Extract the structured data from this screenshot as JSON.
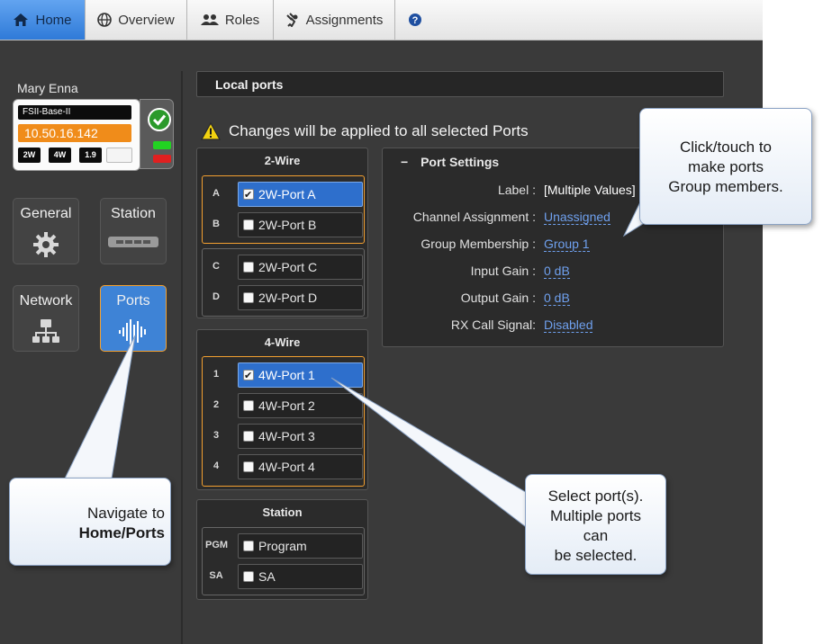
{
  "nav": {
    "tabs": [
      {
        "label": "Home",
        "icon": "home-icon"
      },
      {
        "label": "Overview",
        "icon": "globe-icon"
      },
      {
        "label": "Roles",
        "icon": "users-icon"
      },
      {
        "label": "Assignments",
        "icon": "plug-icon"
      },
      {
        "label": "",
        "icon": "help-icon"
      }
    ]
  },
  "user": {
    "name": "Mary Enna"
  },
  "device": {
    "name": "FSII-Base-II",
    "ip": "10.50.16.142",
    "badges": [
      "2W",
      "4W",
      "1.9"
    ]
  },
  "tiles": [
    {
      "label": "General",
      "icon": "gear-icon"
    },
    {
      "label": "Station",
      "icon": "station-icon"
    },
    {
      "label": "Network",
      "icon": "network-icon"
    },
    {
      "label": "Ports",
      "icon": "audio-wave-icon"
    }
  ],
  "main": {
    "section_title": "Local ports",
    "warning": "Changes will be applied to all selected Ports",
    "two_wire": {
      "title": "2-Wire",
      "ports": [
        {
          "letter": "A",
          "label": "2W-Port A",
          "checked": true
        },
        {
          "letter": "B",
          "label": "2W-Port B",
          "checked": false
        },
        {
          "letter": "C",
          "label": "2W-Port C",
          "checked": false
        },
        {
          "letter": "D",
          "label": "2W-Port D",
          "checked": false
        }
      ]
    },
    "four_wire": {
      "title": "4-Wire",
      "ports": [
        {
          "letter": "1",
          "label": "4W-Port 1",
          "checked": true
        },
        {
          "letter": "2",
          "label": "4W-Port 2",
          "checked": false
        },
        {
          "letter": "3",
          "label": "4W-Port 3",
          "checked": false
        },
        {
          "letter": "4",
          "label": "4W-Port 4",
          "checked": false
        }
      ]
    },
    "station": {
      "title": "Station",
      "ports": [
        {
          "letter": "PGM",
          "label": "Program",
          "checked": false
        },
        {
          "letter": "SA",
          "label": "SA",
          "checked": false
        }
      ]
    },
    "port_settings": {
      "title": "Port Settings",
      "collapse_symbol": "−",
      "rows": [
        {
          "label": "Label :",
          "value": "[Multiple Values]"
        },
        {
          "label": "Channel Assignment :",
          "value": "Unassigned"
        },
        {
          "label": "Group Membership :",
          "value": "Group 1"
        },
        {
          "label": "Input Gain :",
          "value": "0 dB"
        },
        {
          "label": "Output Gain :",
          "value": "0 dB"
        },
        {
          "label": "RX Call Signal:",
          "value": "Disabled"
        }
      ]
    }
  },
  "callouts": {
    "group": [
      "Click/touch to",
      "make ports",
      "Group members."
    ],
    "select": [
      "Select port(s).",
      "Multiple ports",
      "can",
      "be selected."
    ],
    "navigate": [
      "Navigate to",
      "Home/Ports"
    ]
  },
  "colors": {
    "accent_blue": "#2e6fcc",
    "selection_orange": "#f3a030",
    "ip_orange": "#f08c1a",
    "link_blue": "#6fa0ee",
    "panel_bg": "#3a3a3a"
  }
}
